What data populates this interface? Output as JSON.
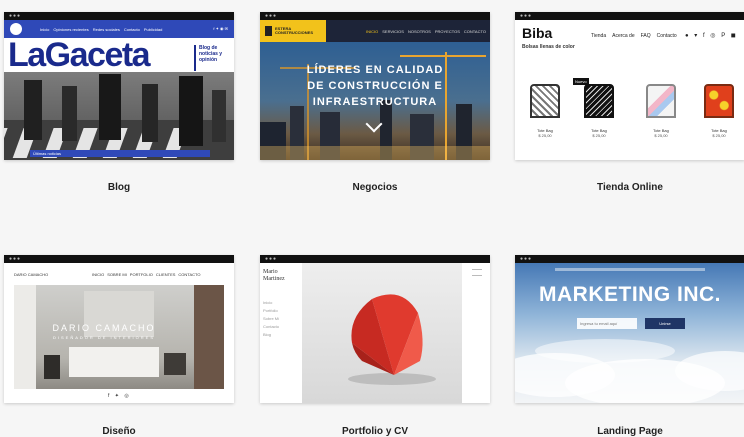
{
  "templates": [
    {
      "caption": "Blog",
      "masthead": "LaGaceta",
      "tagline": "Blog de noticias y opinión",
      "nav": [
        "Inicio",
        "Opiniones recientes",
        "Redes sociales",
        "Contacto",
        "Publicidad"
      ],
      "ticker_label": "Últimas noticias"
    },
    {
      "caption": "Negocios",
      "brand": "ESTERA CONSTRUCCIONES",
      "nav": [
        "INICIO",
        "SERVICIOS",
        "NOSOTROS",
        "PROYECTOS",
        "CONTACTO"
      ],
      "headline": "LÍDERES EN CALIDAD DE CONSTRUCCIÓN E INFRAESTRUCTURA"
    },
    {
      "caption": "Tienda Online",
      "brand": "Biba",
      "subtitle": "Bolsas llenas de color",
      "nav": [
        "Tienda",
        "Acerca de",
        "FAQ",
        "Contacto"
      ],
      "badge": "Nuevo",
      "products": [
        {
          "name": "Tote Bag",
          "price": "$ 25,00"
        },
        {
          "name": "Tote Bag",
          "price": "$ 25,00"
        },
        {
          "name": "Tote Bag",
          "price": "$ 25,00"
        },
        {
          "name": "Tote Bag",
          "price": "$ 25,00"
        }
      ]
    },
    {
      "caption": "Diseño",
      "brand": "DARIO CAMACHO",
      "nav": [
        "INICIO",
        "SOBRE MI",
        "PORTFOLIO",
        "CLIENTES",
        "CONTACTO"
      ],
      "hero_title": "DARIO CAMACHO",
      "hero_sub": "DISEÑADOR DE INTERIORES"
    },
    {
      "caption": "Portfolio y CV",
      "brand": "Mario Martinez",
      "menu": [
        "Inicio",
        "Portfolio",
        "Sobre Mí",
        "Contacto",
        "Blog"
      ]
    },
    {
      "caption": "Landing Page",
      "headline": "MARKETING INC.",
      "email_placeholder": "Ingresa tu email aquí",
      "button": "Unirse"
    }
  ],
  "colors": {
    "blog_blue": "#2f49b8",
    "negocios_yellow": "#f2c21b",
    "landing_navy": "#1f3566"
  }
}
